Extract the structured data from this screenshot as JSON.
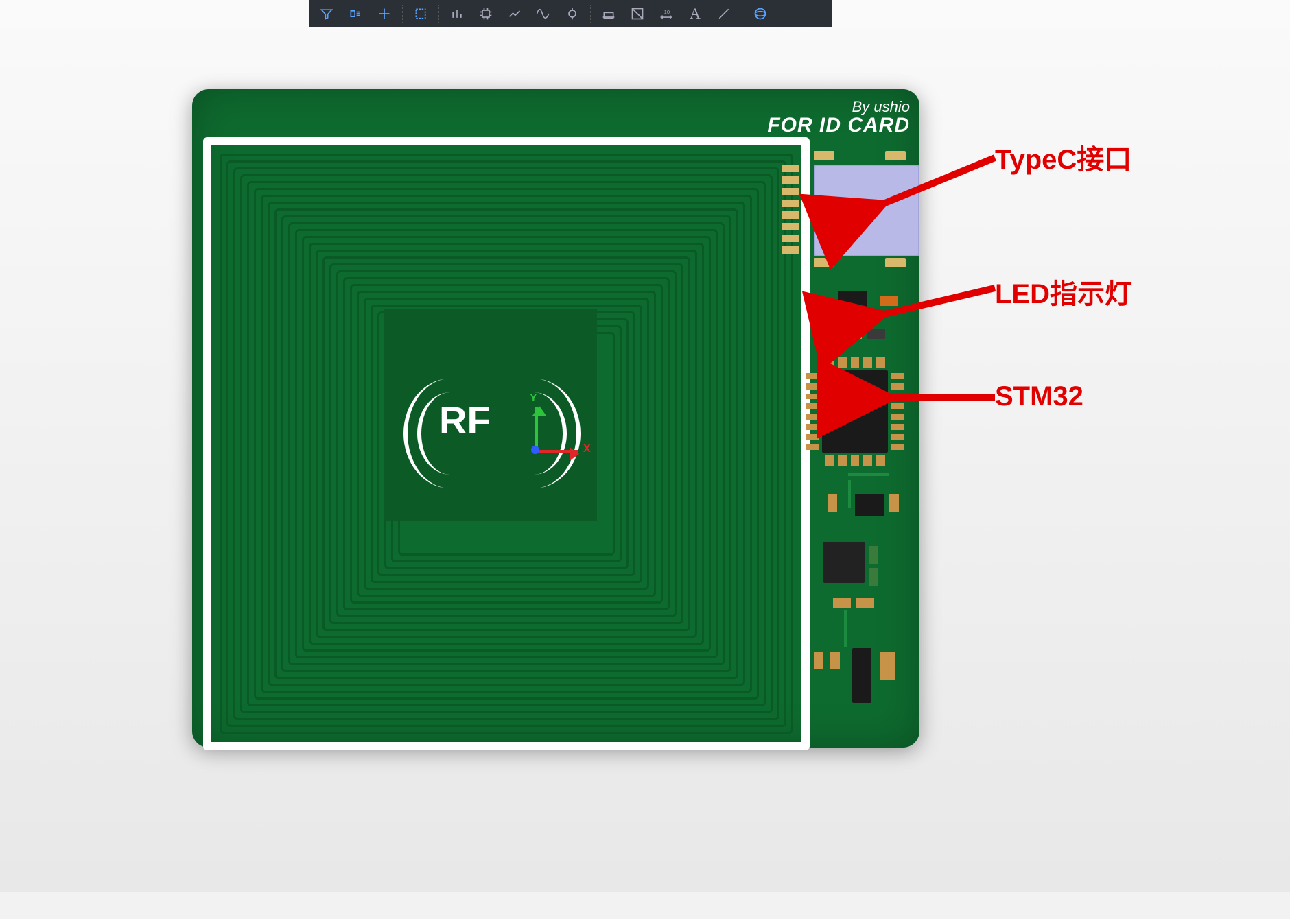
{
  "toolbar": {
    "tools": [
      {
        "name": "filter-icon",
        "active": true
      },
      {
        "name": "snap-grid-icon",
        "active": true
      },
      {
        "name": "crosshair-icon",
        "active": true
      },
      {
        "name": "select-rect-icon",
        "active": true
      },
      {
        "name": "align-icon",
        "active": false
      },
      {
        "name": "component-icon",
        "active": false
      },
      {
        "name": "route-icon",
        "active": false
      },
      {
        "name": "signal-icon",
        "active": false
      },
      {
        "name": "via-icon",
        "active": false
      },
      {
        "name": "copper-pour-icon",
        "active": false
      },
      {
        "name": "measure-icon",
        "active": false
      },
      {
        "name": "dimension-icon",
        "active": false
      },
      {
        "name": "text-icon",
        "active": false
      },
      {
        "name": "line-icon",
        "active": false
      },
      {
        "name": "3d-view-icon",
        "active": true
      }
    ]
  },
  "silkscreen": {
    "credit": "By ushio",
    "title": "FOR ID CARD"
  },
  "pcb": {
    "center_label": "RF",
    "axis_x_label": "X",
    "axis_y_label": "Y"
  },
  "callouts": {
    "typec": "TypeC接口",
    "led": "LED指示灯",
    "stm32": "STM32"
  },
  "colors": {
    "pcb": "#0e6b2f",
    "annotation": "#e00000"
  }
}
